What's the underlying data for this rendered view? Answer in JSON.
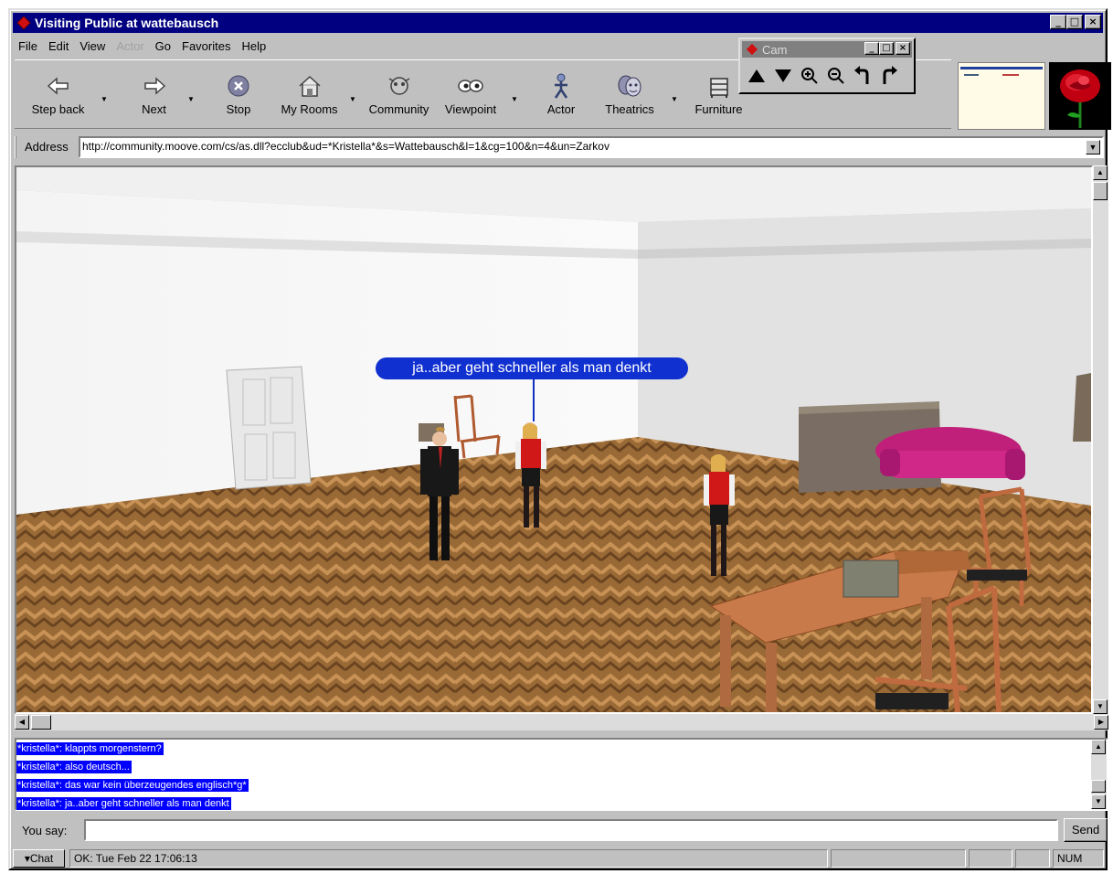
{
  "window": {
    "title": "Visiting Public at wattebausch"
  },
  "menubar": {
    "items": [
      "File",
      "Edit",
      "View",
      "Actor",
      "Go",
      "Favorites",
      "Help"
    ]
  },
  "toolbar": {
    "buttons": [
      {
        "label": "Step back",
        "icon": "back-arrow-icon",
        "dropdown": true
      },
      {
        "label": "Next",
        "icon": "forward-arrow-icon",
        "dropdown": true
      },
      {
        "label": "Stop",
        "icon": "stop-icon",
        "dropdown": false
      },
      {
        "label": "My Rooms",
        "icon": "house-icon",
        "dropdown": true
      },
      {
        "label": "Community",
        "icon": "community-icon",
        "dropdown": false
      },
      {
        "label": "Viewpoint",
        "icon": "eyes-icon",
        "dropdown": true
      },
      {
        "label": "Actor",
        "icon": "actor-icon",
        "dropdown": false
      },
      {
        "label": "Theatrics",
        "icon": "masks-icon",
        "dropdown": true
      },
      {
        "label": "Furniture",
        "icon": "furniture-icon",
        "dropdown": false
      }
    ]
  },
  "cam": {
    "title": "Cam",
    "buttons": [
      "up-arrow-icon",
      "down-arrow-icon",
      "zoom-in-icon",
      "zoom-out-icon",
      "rotate-left-icon",
      "rotate-right-icon"
    ]
  },
  "address": {
    "label": "Address",
    "url": "http://community.moove.com/cs/as.dll?ecclub&ud=*Kristella*&s=Wattebausch&l=1&cg=100&n=4&un=Zarkov"
  },
  "scene": {
    "speech_bubble": "ja..aber geht schneller als man denkt"
  },
  "chatlog": {
    "lines": [
      "*kristella*: klappts morgenstern?",
      "*kristella*: also deutsch...",
      "*kristella*: das war kein überzeugendes englisch*g*",
      "*kristella*: ja..aber geht schneller als man denkt"
    ]
  },
  "input": {
    "label": "You say:",
    "value": "",
    "send_label": "Send"
  },
  "statusbar": {
    "chat_label": "▾Chat",
    "status_text": "OK: Tue Feb 22 17:06:13",
    "indicator": "NUM"
  },
  "colors": {
    "title_active": "#000080",
    "chat_highlight": "#0000ff",
    "chrome": "#c0c0c0"
  }
}
